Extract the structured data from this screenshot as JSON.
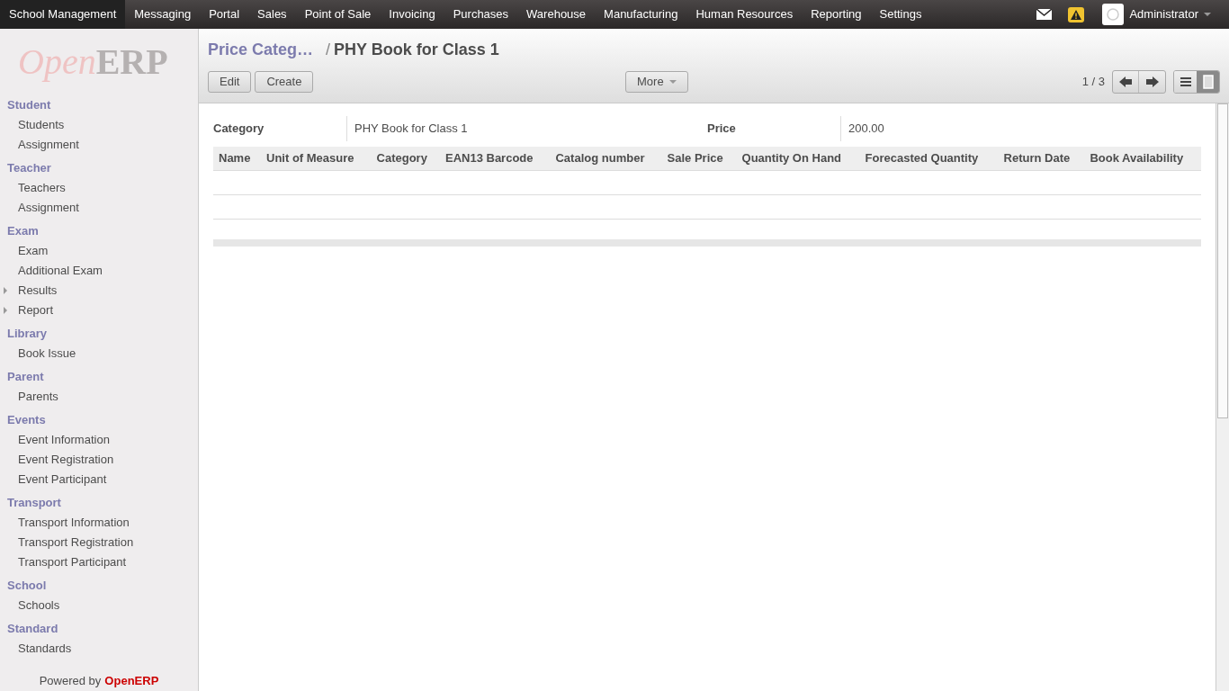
{
  "top_menu": [
    {
      "label": "School Management",
      "selected": true
    },
    {
      "label": "Messaging",
      "selected": false
    },
    {
      "label": "Portal",
      "selected": false
    },
    {
      "label": "Sales",
      "selected": false
    },
    {
      "label": "Point of Sale",
      "selected": false
    },
    {
      "label": "Invoicing",
      "selected": false
    },
    {
      "label": "Purchases",
      "selected": false
    },
    {
      "label": "Warehouse",
      "selected": false
    },
    {
      "label": "Manufacturing",
      "selected": false
    },
    {
      "label": "Human Resources",
      "selected": false
    },
    {
      "label": "Reporting",
      "selected": false
    },
    {
      "label": "Settings",
      "selected": false
    }
  ],
  "user": {
    "name": "Administrator"
  },
  "logo": {
    "first": "Open",
    "second": "ERP"
  },
  "sidebar": [
    {
      "title": "Student",
      "items": [
        {
          "label": "Students",
          "kind": "leaf"
        },
        {
          "label": "Assignment",
          "kind": "leaf"
        }
      ]
    },
    {
      "title": "Teacher",
      "items": [
        {
          "label": "Teachers",
          "kind": "leaf"
        },
        {
          "label": "Assignment",
          "kind": "leaf"
        }
      ]
    },
    {
      "title": "Exam",
      "items": [
        {
          "label": "Exam",
          "kind": "leaf"
        },
        {
          "label": "Additional Exam",
          "kind": "leaf"
        },
        {
          "label": "Results",
          "kind": "folder"
        },
        {
          "label": "Report",
          "kind": "folder"
        }
      ]
    },
    {
      "title": "Library",
      "items": [
        {
          "label": "Book Issue",
          "kind": "leaf"
        }
      ]
    },
    {
      "title": "Parent",
      "items": [
        {
          "label": "Parents",
          "kind": "leaf"
        }
      ]
    },
    {
      "title": "Events",
      "items": [
        {
          "label": "Event Information",
          "kind": "leaf"
        },
        {
          "label": "Event Registration",
          "kind": "leaf"
        },
        {
          "label": "Event Participant",
          "kind": "leaf"
        }
      ]
    },
    {
      "title": "Transport",
      "items": [
        {
          "label": "Transport Information",
          "kind": "leaf"
        },
        {
          "label": "Transport Registration",
          "kind": "leaf"
        },
        {
          "label": "Transport Participant",
          "kind": "leaf"
        }
      ]
    },
    {
      "title": "School",
      "items": [
        {
          "label": "Schools",
          "kind": "leaf"
        }
      ]
    },
    {
      "title": "Standard",
      "items": [
        {
          "label": "Standards",
          "kind": "leaf"
        }
      ]
    }
  ],
  "footer": {
    "prefix": "Powered by",
    "brand": "OpenERP"
  },
  "breadcrumb": {
    "parent": "Price Categ…",
    "separator": "/",
    "current": "PHY Book for Class 1"
  },
  "buttons": [
    "Edit",
    "Create"
  ],
  "more": "More",
  "pager": "1 / 3",
  "views": [
    {
      "kind": "list",
      "selected": false
    },
    {
      "kind": "form",
      "selected": true
    }
  ],
  "fields": [
    {
      "label": "Category",
      "value": "PHY Book for Class 1"
    },
    {
      "label": "Price",
      "value": "200.00"
    }
  ],
  "table": {
    "columns": [
      "Name",
      "Unit of Measure",
      "Category",
      "EAN13 Barcode",
      "Catalog number",
      "Sale Price",
      "Quantity On Hand",
      "Forecasted Quantity",
      "Return Date",
      "Book Availability"
    ]
  }
}
